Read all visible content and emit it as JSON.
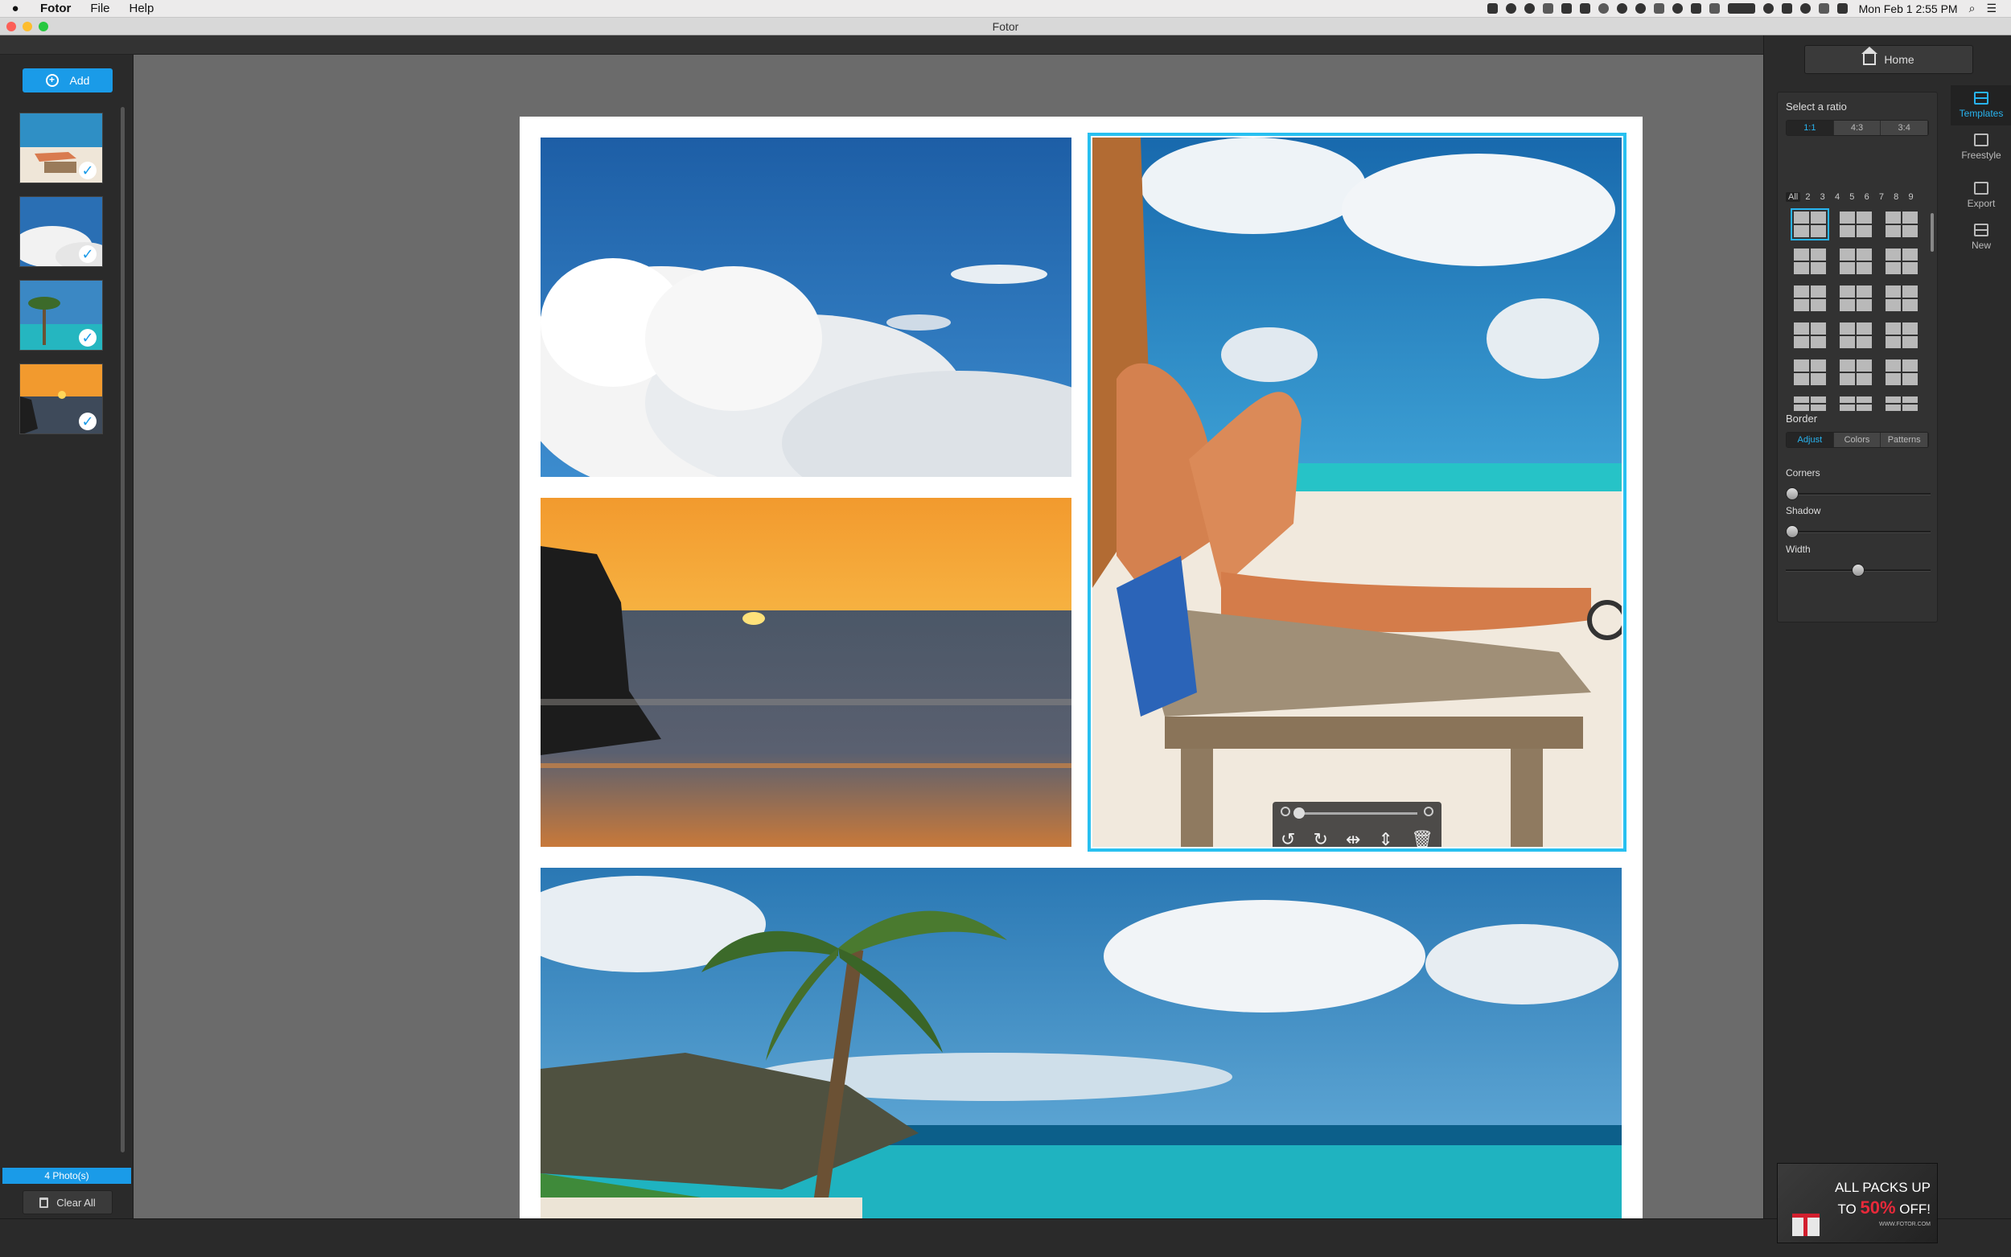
{
  "menubar": {
    "apple_icon": "apple-icon",
    "app_name": "Fotor",
    "items": [
      "File",
      "Help"
    ],
    "clock": "Mon Feb 1  2:55 PM"
  },
  "window": {
    "title": "Fotor"
  },
  "left_panel": {
    "add_label": "Add",
    "photo_count": "4 Photo(s)",
    "clear_all_label": "Clear All"
  },
  "right_panel": {
    "home_label": "Home",
    "select_ratio_label": "Select a ratio",
    "ratios": [
      "1:1",
      "4:3",
      "3:4"
    ],
    "selected_ratio": "1:1",
    "count_filters": [
      "All",
      "2",
      "3",
      "4",
      "5",
      "6",
      "7",
      "8",
      "9"
    ],
    "border_label": "Border",
    "border_tabs": [
      "Adjust",
      "Colors",
      "Patterns"
    ],
    "sliders": [
      {
        "label": "Corners",
        "value": 0
      },
      {
        "label": "Shadow",
        "value": 0
      },
      {
        "label": "Width",
        "value": 0.5
      }
    ],
    "side_tabs": [
      "Templates",
      "Freestyle",
      "Export",
      "New"
    ],
    "ad": {
      "line1": "ALL PACKS UP",
      "line2_pre": "TO",
      "line2_highlight": "50%",
      "line2_post": "OFF!",
      "url": "WWW.FOTOR.COM"
    }
  },
  "colors": {
    "accent": "#1a9be8",
    "selection": "#28c0f0"
  }
}
